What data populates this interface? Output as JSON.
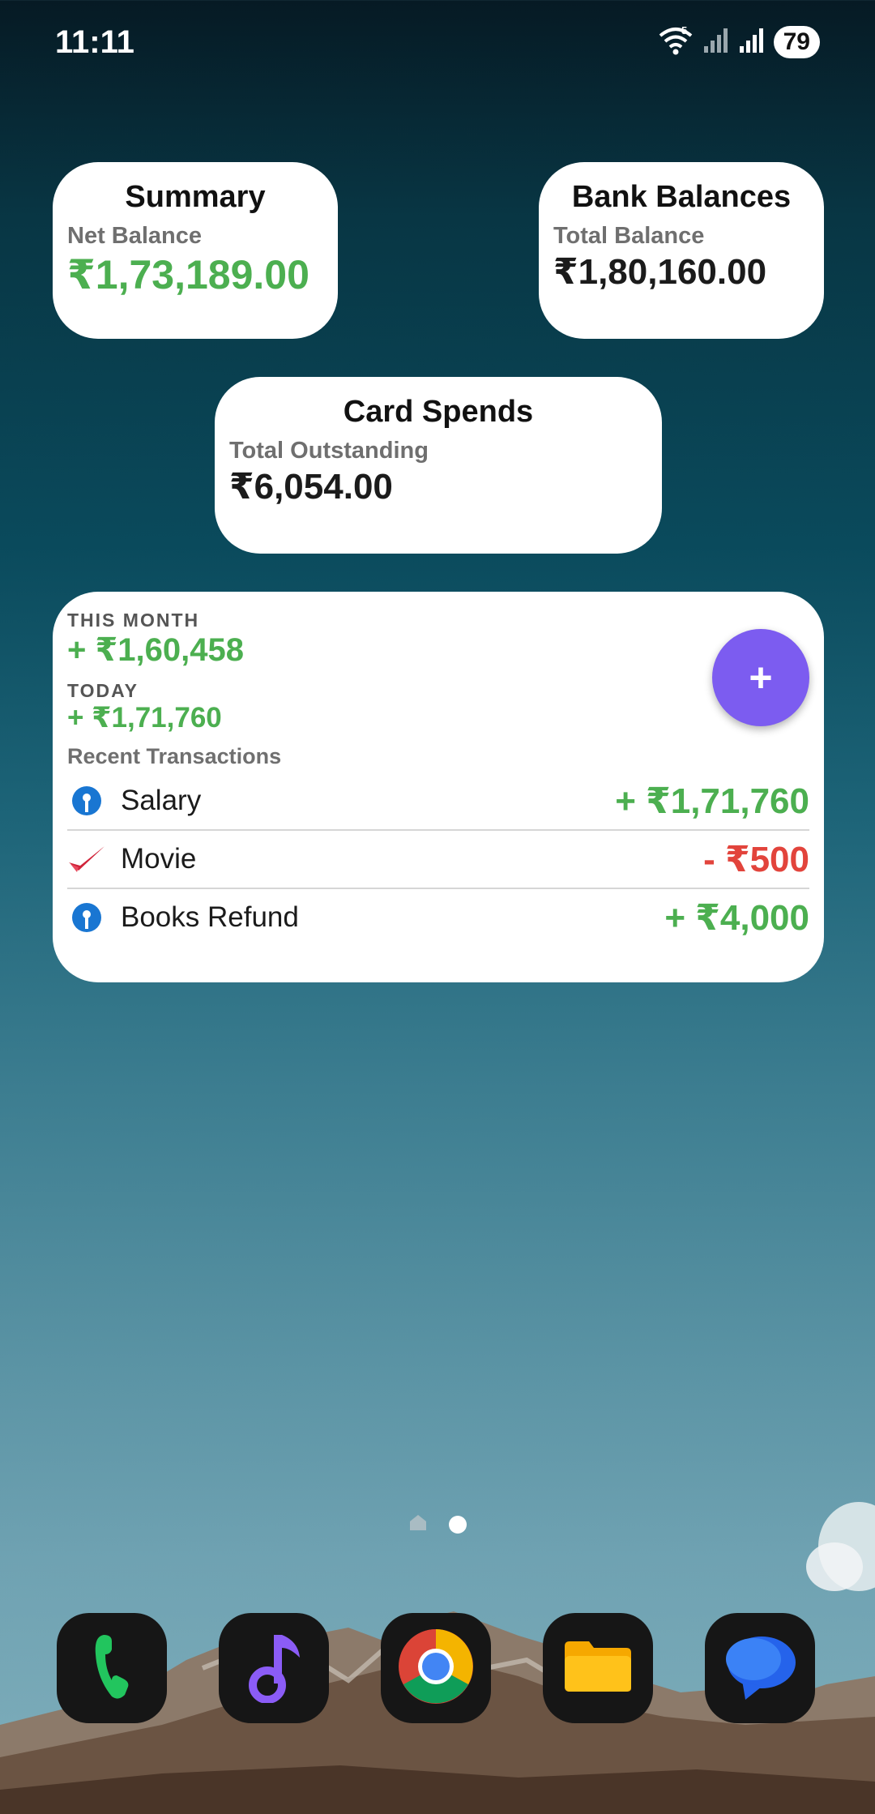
{
  "status_bar": {
    "time": "11:11",
    "network": "5",
    "battery": "79"
  },
  "summary": {
    "title": "Summary",
    "label": "Net Balance",
    "value": "₹1,73,189.00"
  },
  "bank_balances": {
    "title": "Bank Balances",
    "label": "Total Balance",
    "value": "₹1,80,160.00"
  },
  "card_spends": {
    "title": "Card Spends",
    "label": "Total Outstanding",
    "value": "₹6,054.00"
  },
  "recent": {
    "this_month_label": "THIS MONTH",
    "this_month_value": "+ ₹1,60,458",
    "today_label": "TODAY",
    "today_value": "+ ₹1,71,760",
    "add_label": "+",
    "transactions_label": "Recent Transactions",
    "transactions": [
      {
        "name": "Salary",
        "amount": "+ ₹1,71,760",
        "type": "credit",
        "icon": "bank-icon"
      },
      {
        "name": "Movie",
        "amount": "- ₹500",
        "type": "debit",
        "icon": "checkmark-logo-icon"
      },
      {
        "name": "Books Refund",
        "amount": "+ ₹4,000",
        "type": "credit",
        "icon": "bank-icon"
      }
    ]
  },
  "pager": {
    "pages": 2,
    "current": 2
  },
  "dock": [
    {
      "name": "phone",
      "icon": "phone-icon"
    },
    {
      "name": "music",
      "icon": "music-note-icon"
    },
    {
      "name": "chrome",
      "icon": "chrome-icon"
    },
    {
      "name": "files",
      "icon": "folder-icon"
    },
    {
      "name": "messages",
      "icon": "chat-bubble-icon"
    }
  ],
  "colors": {
    "green": "#4caf50",
    "red": "#e2443c",
    "fab": "#7c5cf0"
  }
}
